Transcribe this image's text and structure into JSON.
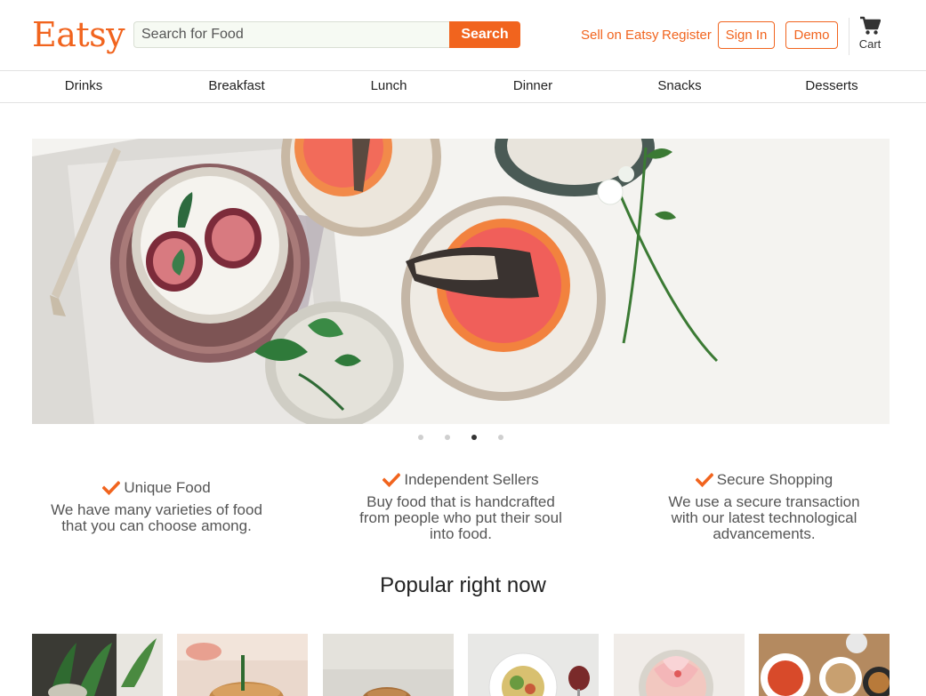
{
  "header": {
    "logo": "Eatsy",
    "search_placeholder": "Search for Food",
    "search_button": "Search",
    "sell_link": "Sell on Eatsy",
    "register_link": "Register",
    "signin_button": "Sign In",
    "demo_button": "Demo",
    "cart_label": "Cart",
    "cart_icon": "cart-icon"
  },
  "categories": [
    "Drinks",
    "Breakfast",
    "Lunch",
    "Dinner",
    "Snacks",
    "Desserts"
  ],
  "carousel": {
    "slide_count": 4,
    "active_index": 2
  },
  "features": [
    {
      "title": "Unique Food",
      "desc": [
        "We have many varieties of food",
        "that you can choose among."
      ],
      "icon": "check-icon"
    },
    {
      "title": "Independent Sellers",
      "desc": [
        "Buy food that is handcrafted",
        "from people who put their soul",
        "into food."
      ],
      "icon": "check-icon"
    },
    {
      "title": "Secure Shopping",
      "desc": [
        "We use a secure transaction",
        "with our latest technological",
        "advancements."
      ],
      "icon": "check-icon"
    }
  ],
  "popular": {
    "title": "Popular right now"
  },
  "colors": {
    "accent": "#f1641e",
    "text": "#222222",
    "muted": "#555555",
    "border": "#e1e1e1"
  }
}
